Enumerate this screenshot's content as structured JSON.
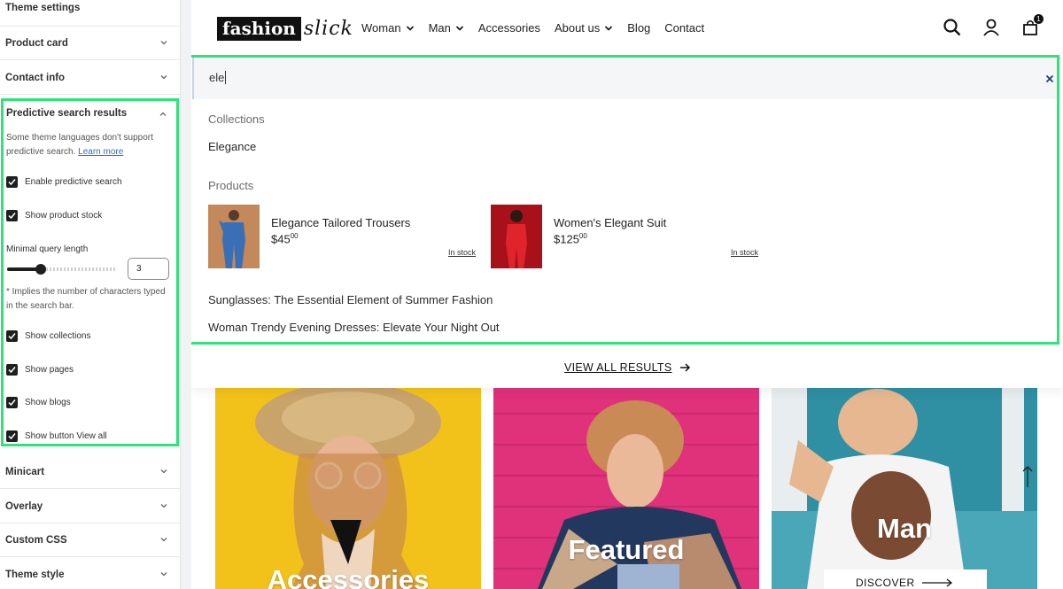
{
  "sidebar": {
    "top_title": "Theme settings",
    "sections_before": [
      "Product card",
      "Contact info"
    ],
    "predictive": {
      "title": "Predictive search results",
      "description": "Some theme languages don't support predictive search.",
      "learn_more": "Learn more",
      "enable_label": "Enable predictive search",
      "stock_label": "Show product stock",
      "min_query_label": "Minimal query length",
      "min_query_value": "3",
      "min_query_slider_level": 0.3,
      "note": "* Implies the number of characters typed in the search bar.",
      "collections_label": "Show collections",
      "pages_label": "Show pages",
      "blogs_label": "Show blogs",
      "view_all_label": "Show button View all"
    },
    "sections_after": [
      "Minicart",
      "Overlay",
      "Custom CSS",
      "Theme style"
    ]
  },
  "store": {
    "logo_bold": "fashion",
    "logo_script": "slick",
    "nav": [
      "Woman",
      "Man",
      "Accessories",
      "About us",
      "Blog",
      "Contact"
    ],
    "cart_count": "1",
    "search": {
      "query": "ele",
      "collections_heading": "Collections",
      "collection_item": "Elegance",
      "products_heading": "Products",
      "products": [
        {
          "name": "Elegance Tailored Trousers",
          "price": "$45",
          "cents": "00",
          "stock": "In stock"
        },
        {
          "name": "Women's Elegant Suit",
          "price": "$125",
          "cents": "00",
          "stock": "In stock"
        }
      ],
      "articles": [
        "Sunglasses: The Essential Element of Summer Fashion",
        "Woman Trendy Evening Dresses: Elevate Your Night Out"
      ],
      "view_all": "VIEW ALL RESULTS"
    },
    "heroes": [
      "Accessories",
      "Featured",
      "Man"
    ],
    "discover": "DISCOVER"
  },
  "colors": {
    "highlight": "#2fe27a",
    "accent_link": "#2c6ecb"
  }
}
